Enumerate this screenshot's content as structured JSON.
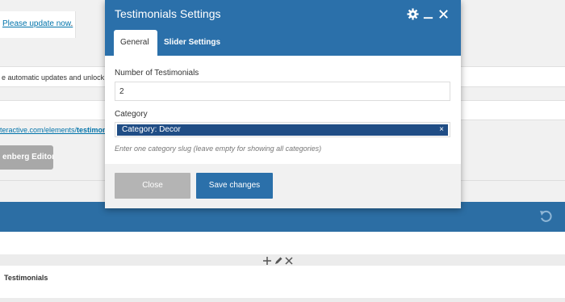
{
  "background": {
    "notice_link": "Please update now",
    "notice_suffix": ".",
    "updates_text": "e automatic updates and unlock p",
    "url_prefix": "teractive.com/elements/",
    "url_bold": "testimon",
    "gutenberg_button": "enberg Editor",
    "element_title": "Testimonials"
  },
  "modal": {
    "title": "Testimonials Settings",
    "tabs": [
      {
        "label": "General",
        "active": true
      },
      {
        "label": "Slider Settings",
        "active": false
      }
    ],
    "fields": {
      "number_label": "Number of Testimonials",
      "number_value": "2",
      "category_label": "Category",
      "category_chip": "Category: Decor",
      "category_hint": "Enter one category slug (leave empty for showing all categories)"
    },
    "buttons": {
      "close": "Close",
      "save": "Save changes"
    }
  },
  "icons": {
    "gear": "gear-icon",
    "minimize": "minimize-icon",
    "close": "close-icon",
    "undo": "undo-icon",
    "add": "plus-icon",
    "edit": "pencil-icon",
    "remove": "close-icon",
    "chip_remove": "×"
  },
  "colors": {
    "accent": "#2b70aa",
    "chip": "#204d85",
    "close_button": "#b4b4b4"
  }
}
